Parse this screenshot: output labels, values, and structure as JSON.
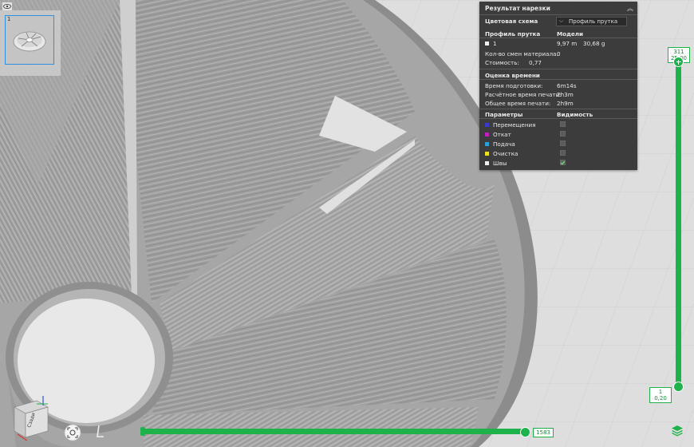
{
  "viewport": {
    "background": "#dcdcdc",
    "model_color": "#9a9a9a"
  },
  "thumbnail": {
    "index": "1"
  },
  "slice_panel": {
    "title": "Результат нарезки",
    "color_scheme_label": "Цветовая схема",
    "color_scheme_value": "Профиль прутка",
    "profile_header": "Профиль прутка",
    "models_header": "Модели",
    "profile_row": {
      "id": "1",
      "length": "9,97 m",
      "weight": "30,68 g"
    },
    "material_changes_label": "Кол-во смен материала:",
    "material_changes_value": "0",
    "cost_label": "Стоимость:",
    "cost_value": "0,77",
    "time_header": "Оценка времени",
    "prep_time_label": "Время подготовки:",
    "prep_time_value": "6m14s",
    "print_time_label": "Расчётное время печати:",
    "print_time_value": "2h3m",
    "total_time_label": "Общее время печати:",
    "total_time_value": "2h9m",
    "params_header": "Параметры",
    "visibility_header": "Видимость",
    "params": [
      {
        "label": "Перемещения",
        "color": "#3a3ad0",
        "visible": false
      },
      {
        "label": "Откат",
        "color": "#c020c0",
        "visible": false
      },
      {
        "label": "Подача",
        "color": "#2aa0d8",
        "visible": false
      },
      {
        "label": "Очистка",
        "color": "#f0e020",
        "visible": false
      },
      {
        "label": "Швы",
        "color": "#f0f0f0",
        "visible": true
      }
    ]
  },
  "layer_slider": {
    "top_layer": "311",
    "top_height": "25,00",
    "bottom_layer": "1",
    "bottom_height": "0,20"
  },
  "move_slider": {
    "value": "1583"
  },
  "view_cube": {
    "face_label": "Сзади"
  },
  "accent": "#1db34a"
}
